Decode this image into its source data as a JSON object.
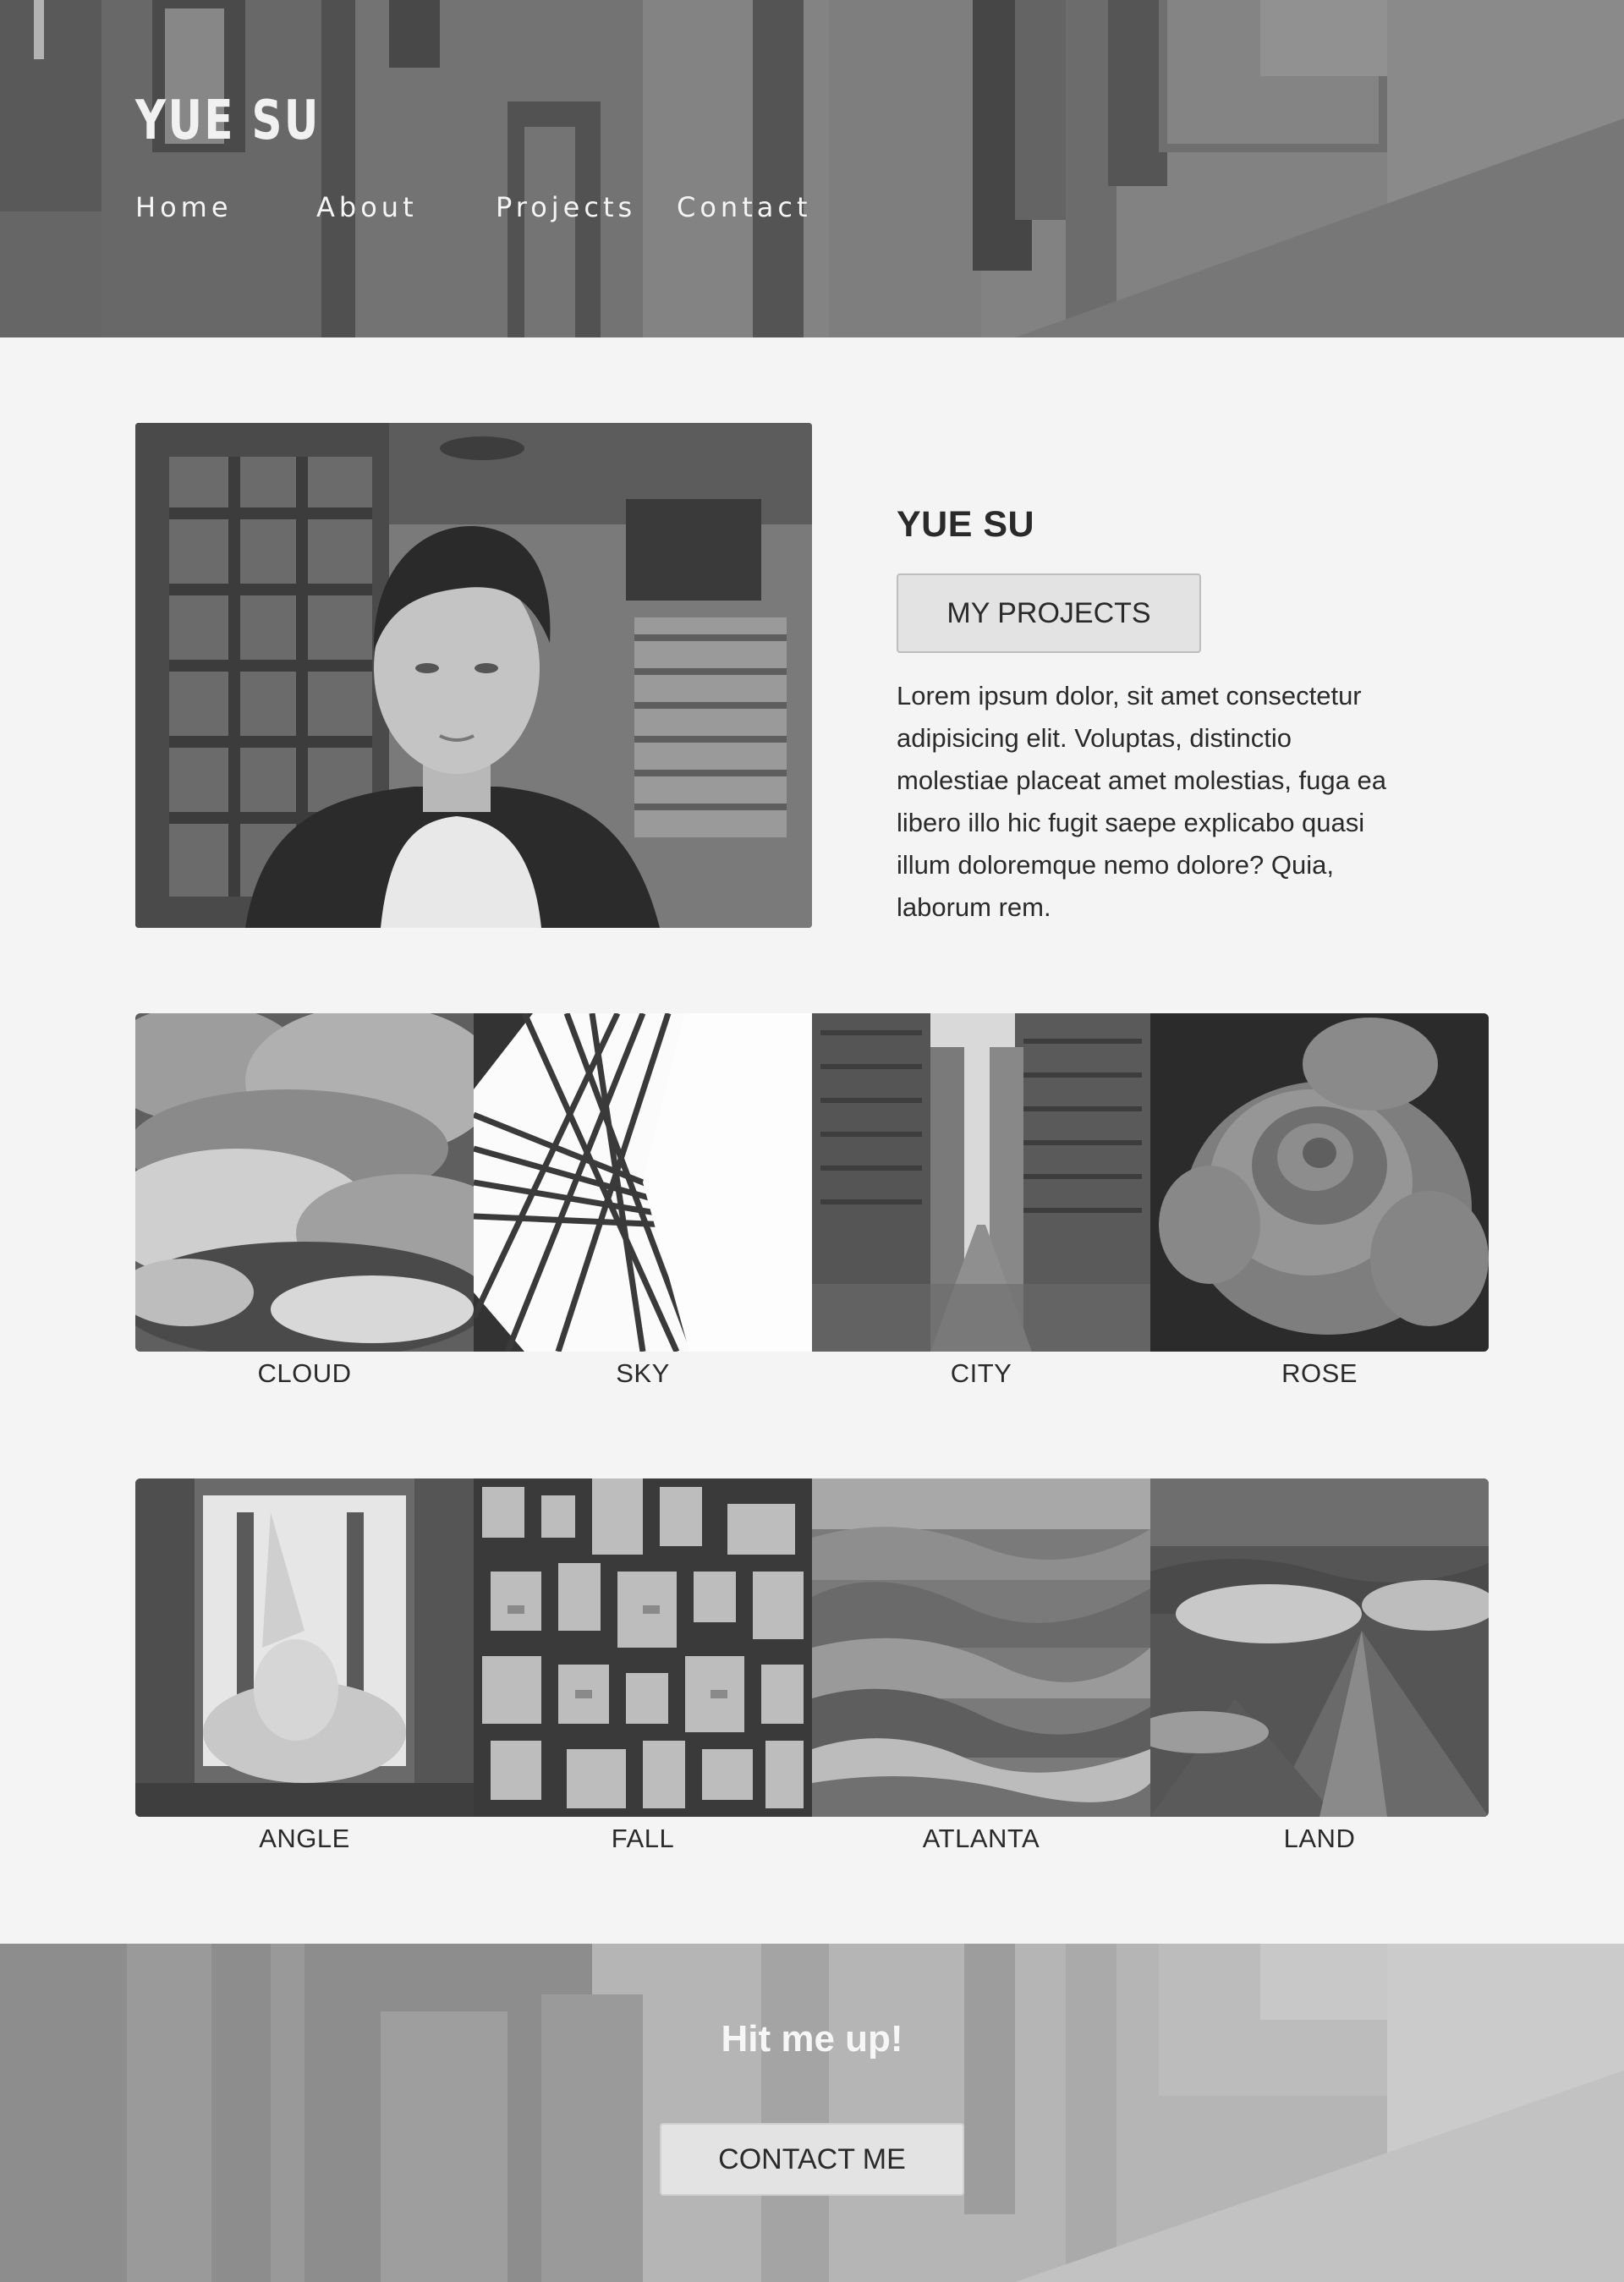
{
  "header": {
    "logo": "YUE SU",
    "nav": [
      {
        "label": "Home"
      },
      {
        "label": "About"
      },
      {
        "label": "Projects"
      },
      {
        "label": "Contact"
      }
    ]
  },
  "intro": {
    "name": "YUE SU",
    "button_label": "MY PROJECTS",
    "text": "Lorem ipsum dolor, sit amet consectetur adipisicing elit. Voluptas, distinctio molestiae placeat amet molestias, fuga ea libero illo hic fugit saepe explicabo quasi illum doloremque nemo dolore? Quia, laborum rem."
  },
  "gallery": [
    {
      "caption": "CLOUD"
    },
    {
      "caption": "SKY"
    },
    {
      "caption": "CITY"
    },
    {
      "caption": "ROSE"
    },
    {
      "caption": "ANGLE"
    },
    {
      "caption": "FALL"
    },
    {
      "caption": "ATLANTA"
    },
    {
      "caption": "LAND"
    }
  ],
  "footer": {
    "heading": "Hit me up!",
    "button_label": "CONTACT ME"
  },
  "colors": {
    "page_background": "#f4f4f4",
    "button_background": "#e3e3e3",
    "text": "#2a2a2a"
  }
}
